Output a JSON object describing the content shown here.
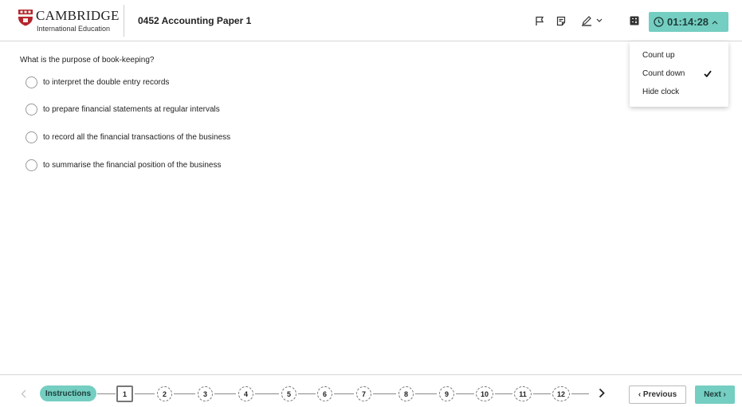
{
  "header": {
    "brand_name": "CAMBRIDGE",
    "brand_sub": "International Education",
    "paper_title": "0452 Accounting Paper 1",
    "timer": "01:14:28",
    "accent_color": "#74cec1"
  },
  "timer_menu": {
    "items": [
      "Count up",
      "Count down",
      "Hide clock"
    ],
    "selected": "Count down"
  },
  "question": {
    "text": "What is the purpose of book-keeping?",
    "options": [
      "to interpret the double entry records",
      "to prepare financial statements at regular intervals",
      "to record all the financial transactions of the business",
      "to summarise the financial position of the business"
    ]
  },
  "footer": {
    "instructions_label": "Instructions",
    "questions": [
      "1",
      "2",
      "3",
      "4",
      "5",
      "6",
      "7",
      "8",
      "9",
      "10",
      "11",
      "12"
    ],
    "current_question": "1",
    "previous_label": "‹ Previous",
    "next_label": "Next ›"
  }
}
